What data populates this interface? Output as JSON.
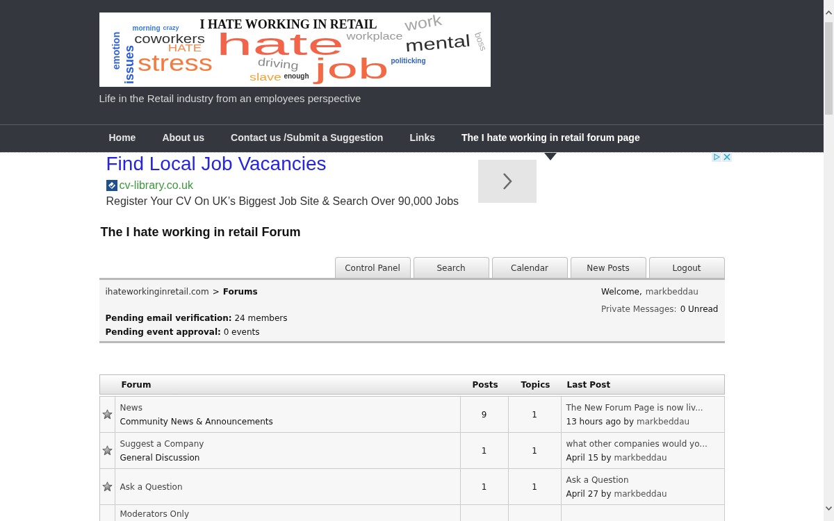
{
  "header": {
    "logo": {
      "title": "I HATE WORKING IN RETAIL",
      "words": [
        {
          "text": "hate",
          "color": "#f2634a"
        },
        {
          "text": "stress",
          "color": "#f47b3f"
        },
        {
          "text": "job",
          "color": "#f26a45"
        },
        {
          "text": "mental",
          "color": "#2e2e2e"
        },
        {
          "text": "coworkers",
          "color": "#333333"
        },
        {
          "text": "HATE",
          "color": "#f58a4a"
        },
        {
          "text": "driving",
          "color": "#8a8a8a"
        },
        {
          "text": "slave",
          "color": "#f2a43c"
        },
        {
          "text": "workplace",
          "color": "#9a9a9a"
        },
        {
          "text": "work",
          "color": "#a5a5a5"
        },
        {
          "text": "issues",
          "color": "#2a5bd7"
        },
        {
          "text": "emotion",
          "color": "#3566d6"
        },
        {
          "text": "enough",
          "color": "#333333"
        },
        {
          "text": "politicking",
          "color": "#2f62c9"
        },
        {
          "text": "boss",
          "color": "#aaaaaa"
        },
        {
          "text": "morning",
          "color": "#3a7bd5"
        },
        {
          "text": "crazy",
          "color": "#3a7bd5"
        }
      ]
    },
    "tagline": "Life in the Retail industry from an employees perspective"
  },
  "nav": [
    {
      "label": "Home",
      "selected": false
    },
    {
      "label": "About us",
      "selected": false
    },
    {
      "label": "Contact us /Submit a Suggestion",
      "selected": false
    },
    {
      "label": "Links",
      "selected": false
    },
    {
      "label": "The I hate working in retail forum page",
      "selected": true
    }
  ],
  "ad": {
    "headline": "Find Local Job Vacancies",
    "domain": "cv-library.co.uk",
    "description": "Register Your CV On UK’s Biggest Job Site & Search Over 90,000 Jobs"
  },
  "page_title": "The I hate working in retail Forum",
  "forum_tabs": [
    "Control Panel",
    "Search",
    "Calendar",
    "New Posts",
    "Logout"
  ],
  "welcome_panel": {
    "breadcrumb": {
      "site": "ihateworkinginretail.com",
      "separator": ">",
      "current": "Forums"
    },
    "welcome": "Welcome,",
    "username": "markbeddau",
    "messages_label": "Private Messages:",
    "messages_count": "0 Unread",
    "notices": [
      "**Pending email verification:** 24 members",
      "**Pending event approval:** 0 events"
    ]
  },
  "forum_table": {
    "columns": [
      "Forum",
      "Posts",
      "Topics",
      "Last Post"
    ],
    "rows": [
      {
        "name": "News",
        "description": "Community News & Announcements",
        "posts": "9",
        "topics": "1",
        "last_post": {
          "title": "The New Forum Page is now liv...",
          "date": "13 hours ago by",
          "user": "markbeddau"
        }
      },
      {
        "name": "Suggest a Company",
        "description": "General Discussion",
        "posts": "1",
        "topics": "1",
        "last_post": {
          "title": "what other companies would yo...",
          "date": "April 15 by",
          "user": "markbeddau"
        }
      },
      {
        "name": "Ask a Question",
        "posts": "1",
        "topics": "1",
        "last_post": {
          "title": "Ask a Question",
          "date": "April 27 by",
          "user": "markbeddau"
        }
      },
      {
        "name": "Moderators Only"
      }
    ]
  }
}
